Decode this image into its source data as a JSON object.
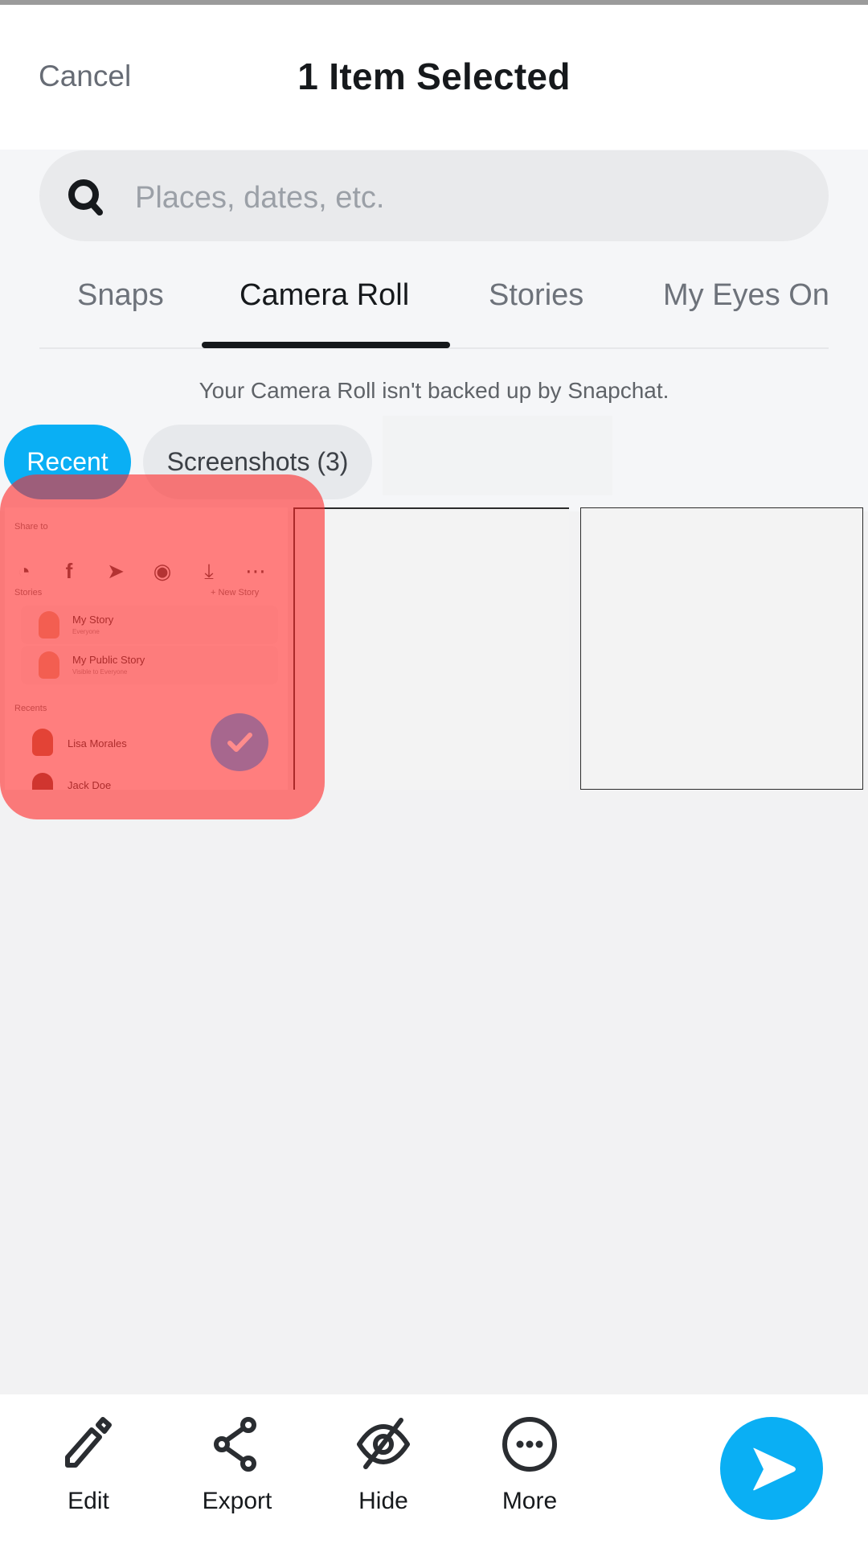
{
  "header": {
    "cancel_label": "Cancel",
    "title": "1 Item Selected"
  },
  "search": {
    "placeholder": "Places, dates, etc.",
    "value": "",
    "icon": "search-icon"
  },
  "tabs": [
    {
      "label": "Snaps",
      "active": false
    },
    {
      "label": "Camera Roll",
      "active": true
    },
    {
      "label": "Stories",
      "active": false
    },
    {
      "label": "My Eyes Only",
      "active": false
    }
  ],
  "notice": "Your Camera Roll isn't backed up by Snapchat.",
  "filters": [
    {
      "label": "Recent",
      "active": true
    },
    {
      "label": "Screenshots (3)",
      "active": false
    }
  ],
  "grid": {
    "selected_count": 1,
    "items": [
      {
        "selected": true,
        "thumbnail": {
          "share_label": "Share to",
          "share_icons": [
            "messenger-icon",
            "facebook-icon",
            "telegram-icon",
            "discord-icon",
            "download-icon",
            "more-icon"
          ],
          "stories_label": "Stories",
          "new_story_label": "+ New Story",
          "stories": [
            {
              "name": "My Story",
              "sub": "Everyone"
            },
            {
              "name": "My Public Story",
              "sub": "Visible to Everyone"
            }
          ],
          "recents_label": "Recents",
          "recents": [
            {
              "name": "Lisa Morales"
            },
            {
              "name": "Jack Doe"
            }
          ]
        }
      },
      {
        "selected": false
      },
      {
        "selected": false
      }
    ]
  },
  "actions": [
    {
      "label": "Edit",
      "icon": "pencil-icon"
    },
    {
      "label": "Export",
      "icon": "share-icon"
    },
    {
      "label": "Hide",
      "icon": "eye-slash-icon"
    },
    {
      "label": "More",
      "icon": "more-icon"
    }
  ],
  "send": {
    "icon": "send-arrow-icon"
  },
  "colors": {
    "accent": "#0aaff4",
    "selection_overlay": "#ff2828",
    "text_primary": "#16191c",
    "text_secondary": "#6d727a"
  }
}
